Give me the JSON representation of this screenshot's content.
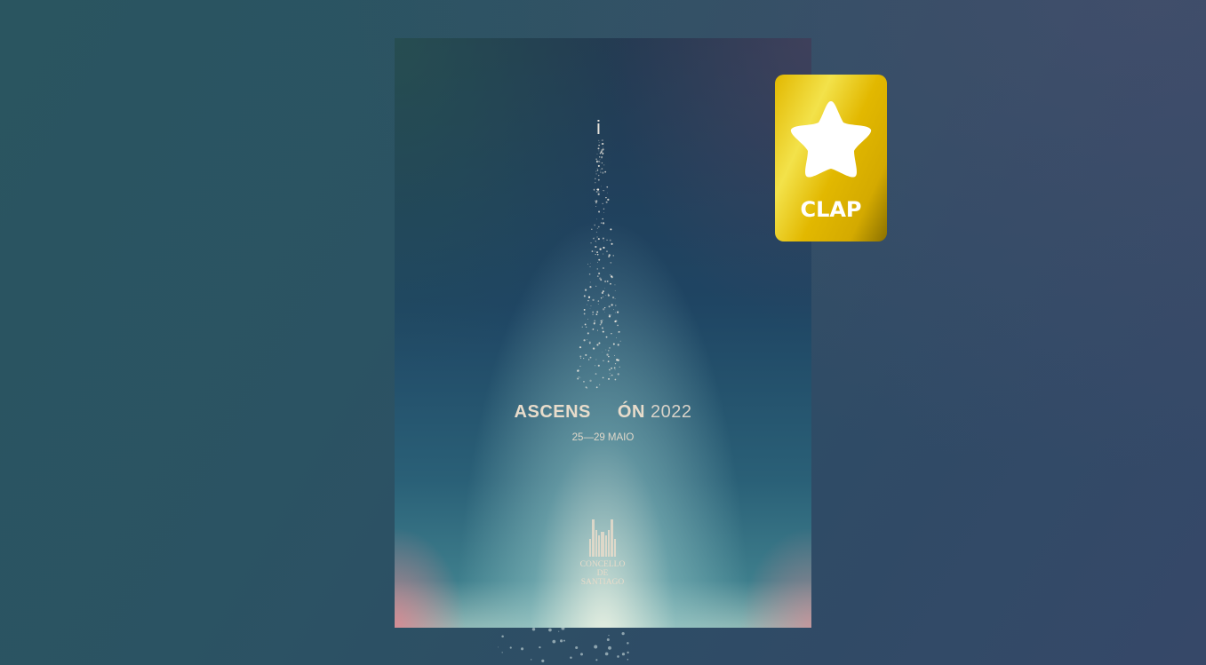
{
  "poster": {
    "rising_letter": "i",
    "title_part1": "ASCENS",
    "title_part2": "ÓN",
    "year": "2022",
    "dates": "25—29 MAIO",
    "logo_line1": "CONCELLO DE",
    "logo_line2": "SANTIAGO"
  },
  "badge": {
    "label": "CLAP",
    "icon": "star-icon",
    "color": "#e2b800"
  }
}
